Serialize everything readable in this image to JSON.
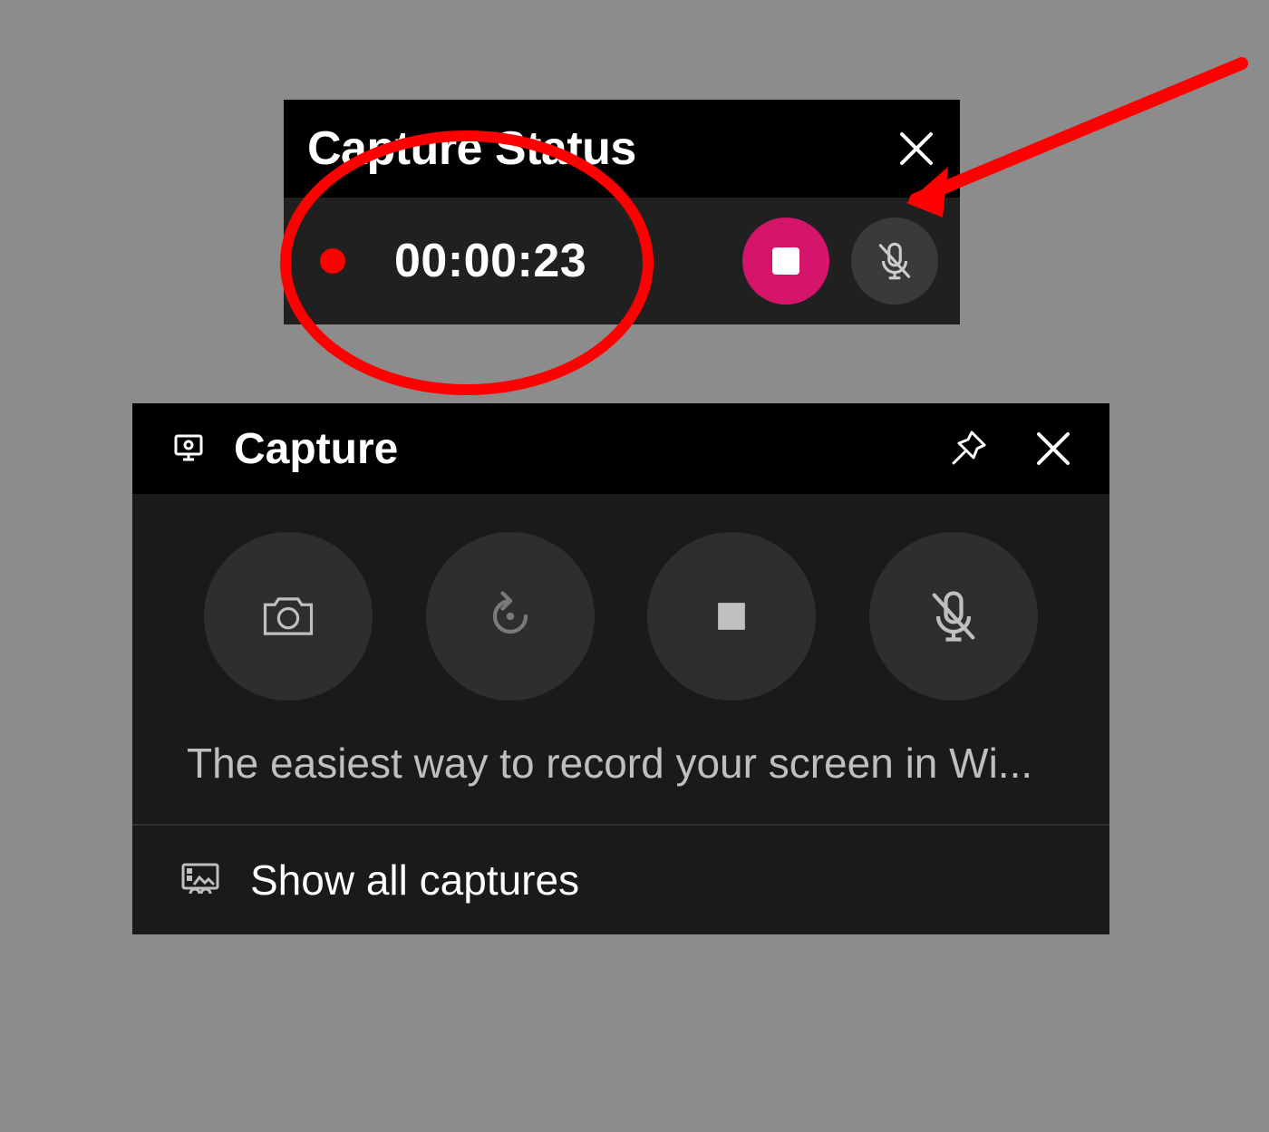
{
  "status_widget": {
    "title": "Capture Status",
    "close_label": "Close",
    "timer": "00:00:23",
    "stop_label": "Stop recording",
    "mic_label": "Microphone muted"
  },
  "capture_widget": {
    "title": "Capture",
    "pin_label": "Pin",
    "close_label": "Close",
    "buttons": {
      "screenshot": "Take screenshot",
      "record_last": "Record last 30 seconds",
      "stop": "Stop recording",
      "mic": "Microphone muted"
    },
    "hint": "The easiest way to record your screen in Wi...",
    "show_all": "Show all captures"
  },
  "annotation": {
    "color": "#ff0000",
    "ellipse_note": "annotation circle around recording timer",
    "arrow_note": "annotation arrow pointing to mic button"
  }
}
